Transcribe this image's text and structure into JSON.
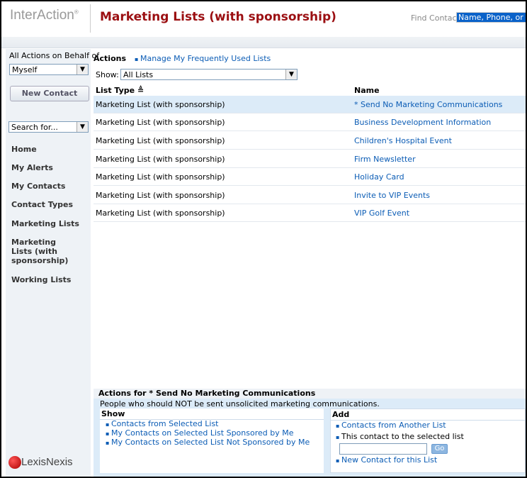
{
  "header": {
    "logo": "InterAction",
    "logo_mark": "®",
    "title": "Marketing Lists (with sponsorship)",
    "find_label": "Find Contact:",
    "find_value": "Name, Phone, or E-mail"
  },
  "sidebar": {
    "behalf_label": "All Actions on Behalf of",
    "behalf_value": "Myself",
    "new_contact": "New Contact",
    "search_value": "Search for...",
    "nav": [
      "Home",
      "My Alerts",
      "My Contacts",
      "Contact Types",
      "Marketing Lists",
      "Marketing Lists (with sponsorship)",
      "Working Lists"
    ],
    "footer_logo": "LexisNexis"
  },
  "main": {
    "actions_label": "Actions",
    "manage_link": "Manage My Frequently Used Lists",
    "show_label": "Show:",
    "show_value": "All Lists",
    "columns": {
      "type": "List Type",
      "name": "Name",
      "sort": "≜"
    },
    "rows": [
      {
        "type": "Marketing List (with sponsorship)",
        "name": "* Send No Marketing Communications"
      },
      {
        "type": "Marketing List (with sponsorship)",
        "name": "Business Development Information"
      },
      {
        "type": "Marketing List (with sponsorship)",
        "name": "Children's Hospital Event"
      },
      {
        "type": "Marketing List (with sponsorship)",
        "name": "Firm Newsletter"
      },
      {
        "type": "Marketing List (with sponsorship)",
        "name": "Holiday Card"
      },
      {
        "type": "Marketing List (with sponsorship)",
        "name": "Invite to VIP Events"
      },
      {
        "type": "Marketing List (with sponsorship)",
        "name": "VIP Golf Event"
      }
    ]
  },
  "bottom": {
    "title": "Actions for * Send No Marketing Communications",
    "description": "People who should NOT be sent unsolicited marketing communications.",
    "show_title": "Show",
    "show_links": [
      "Contacts from Selected List",
      "My Contacts on Selected List Sponsored by Me",
      "My Contacts on Selected List Not Sponsored by Me"
    ],
    "add_title": "Add",
    "add_from": "Contacts from Another List",
    "add_this": "This contact to the selected list",
    "go": "Go",
    "add_new": "New Contact for this List"
  }
}
